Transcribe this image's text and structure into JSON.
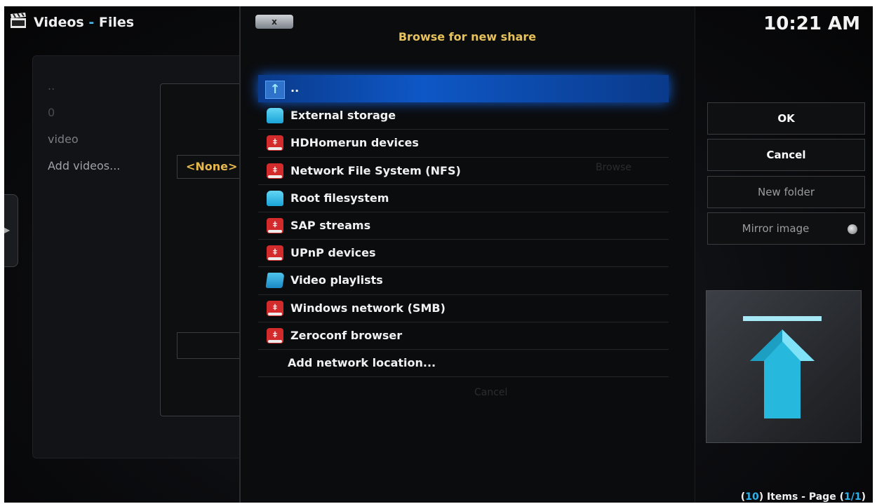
{
  "header": {
    "app": "Videos",
    "separator": "-",
    "section": "Files"
  },
  "clock": "10:21 AM",
  "background": {
    "items": [
      "..",
      "0",
      "video",
      "Add videos..."
    ],
    "none_value": "<None>",
    "ghost_browse": "Browse",
    "ghost_cancel": "Cancel"
  },
  "dialog": {
    "close_label": "x",
    "title": "Browse for new share",
    "items": [
      {
        "label": "..",
        "icon": "parent-folder-icon"
      },
      {
        "label": "External storage",
        "icon": "drive-icon"
      },
      {
        "label": "HDHomerun devices",
        "icon": "network-share-icon"
      },
      {
        "label": "Network File System (NFS)",
        "icon": "network-share-icon"
      },
      {
        "label": "Root filesystem",
        "icon": "drive-icon"
      },
      {
        "label": "SAP streams",
        "icon": "network-share-icon"
      },
      {
        "label": "UPnP devices",
        "icon": "network-share-icon"
      },
      {
        "label": "Video playlists",
        "icon": "folder-icon"
      },
      {
        "label": "Windows network (SMB)",
        "icon": "network-share-icon"
      },
      {
        "label": "Zeroconf browser",
        "icon": "network-share-icon"
      },
      {
        "label": "Add network location...",
        "icon": ""
      }
    ]
  },
  "buttons": {
    "ok": "OK",
    "cancel": "Cancel",
    "new_folder": "New folder",
    "mirror_image": "Mirror image"
  },
  "footer": {
    "count": "10",
    "items_text": "Items - Page",
    "page": "1/1"
  },
  "colors": {
    "accent": "#2fb2ea",
    "title": "#e7c25b",
    "selection": "#0e57c6"
  }
}
